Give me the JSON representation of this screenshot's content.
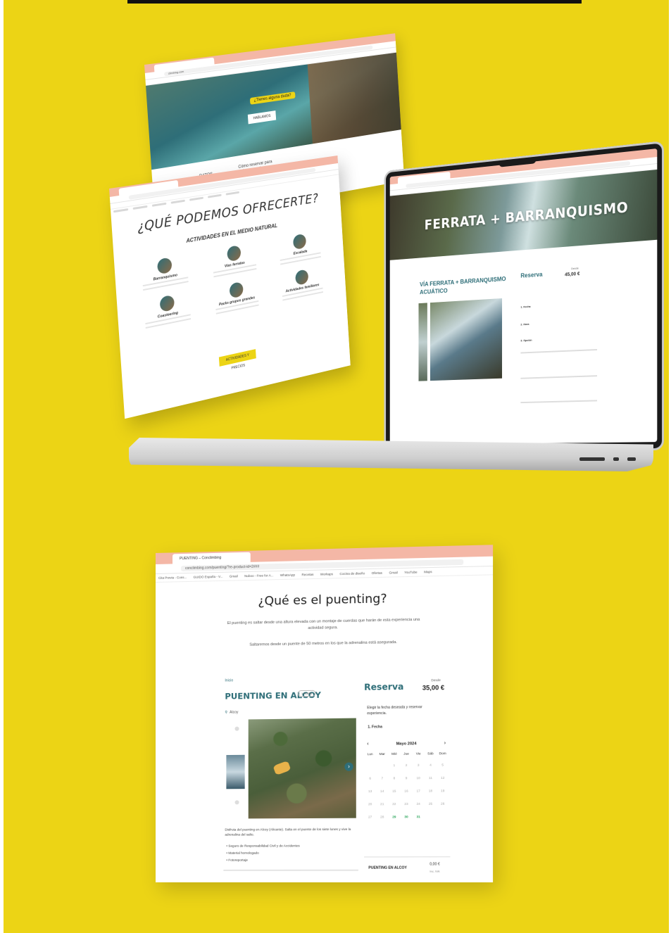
{
  "windowA": {
    "url": "climbing.com",
    "hero_pill": "¿Tienes alguna duda?",
    "hero_button": "HABLAMOS",
    "tab_datos": "DATOS",
    "tab_como": "Cómo reservar para todo momento"
  },
  "windowB": {
    "heading": "¿QUÉ PODEMOS OFRECERTE?",
    "subheading": "ACTIVIDADES EN EL MEDIO NATURAL",
    "cards": [
      {
        "title": "Barranquismo"
      },
      {
        "title": "Vías ferratas"
      },
      {
        "title": "Escalada"
      },
      {
        "title": "Coasteering"
      },
      {
        "title": "Packs grupos grandes"
      },
      {
        "title": "Actividades familiares"
      }
    ],
    "cta": "ACTIVIDADES Y PRECIOS"
  },
  "laptop": {
    "banner_title": "FERRATA + BARRANQUISMO",
    "activity_title": "VÍA FERRATA + BARRANQUISMO ACUÁTICO",
    "reserva": "Reserva",
    "desde": "Desde",
    "price": "45,00 €",
    "row1": "1. Fecha",
    "row2": "2. Hora",
    "row3": "3. Opción"
  },
  "main": {
    "tab_title": "PUENTING – Conclimbing",
    "url": "conclimbing.com/puenting/?re-product-id=2###",
    "bookmarks": [
      "Cita Previa - Cons...",
      "GUIDO España - V...",
      "Gmail",
      "Nuboo - Free for A...",
      "WhatsApp",
      "Recetas",
      "Workaps",
      "Cocina de diseño",
      "Ofertas",
      "Gmail",
      "YouTube",
      "Maps"
    ],
    "question": "¿Qué es el puenting?",
    "intro": "El puenting es saltar desde una altura elevada con un montaje de cuerdas que harán de esta experiencia una actividad segura.",
    "intro2": "Saltaremos desde un puente de 50 metros en los que la adrenalina está asegurada.",
    "breadcrumb": "Inicio",
    "product_title": "PUENTING EN ALCOY",
    "duration_badge": "1 HORA",
    "location": "Alcoy",
    "description": "Disfruta del puenting en Alcoy (Alicante). Salta en el puente de los siete lunes y vive la adrenalina del salto.",
    "features": [
      "Seguro de Responsabilidad Civil y de Accidentes",
      "Material homologado",
      "Fotoreportaje"
    ],
    "reserva": "Reserva",
    "desde": "Desde",
    "price": "35,00 €",
    "reserva_text": "Elegir la fecha deseada y reservar experiencia.",
    "fecha_label": "1. Fecha",
    "calendar": {
      "month": "Mayo 2024",
      "prev": "‹",
      "next": "›",
      "dow": [
        "Lun",
        "Mar",
        "Mié",
        "Jue",
        "Vie",
        "Sáb",
        "Dom"
      ],
      "weeks": [
        [
          "",
          "",
          "1",
          "2",
          "3",
          "4",
          "5"
        ],
        [
          "6",
          "7",
          "8",
          "9",
          "10",
          "11",
          "12"
        ],
        [
          "13",
          "14",
          "15",
          "16",
          "17",
          "18",
          "19"
        ],
        [
          "20",
          "21",
          "22",
          "23",
          "24",
          "25",
          "26"
        ],
        [
          "27",
          "28",
          "29",
          "30",
          "31",
          "",
          ""
        ]
      ],
      "available": [
        "29",
        "30",
        "31"
      ]
    },
    "summary_name": "PUENTING EN ALCOY",
    "summary_price": "0,00 €",
    "summary_iva": "Inc. IVA"
  },
  "colors": {
    "background": "#ecd415",
    "browser_chrome": "#f4b7a6",
    "accent": "#2e6e78",
    "available_day": "#2aa55a"
  }
}
